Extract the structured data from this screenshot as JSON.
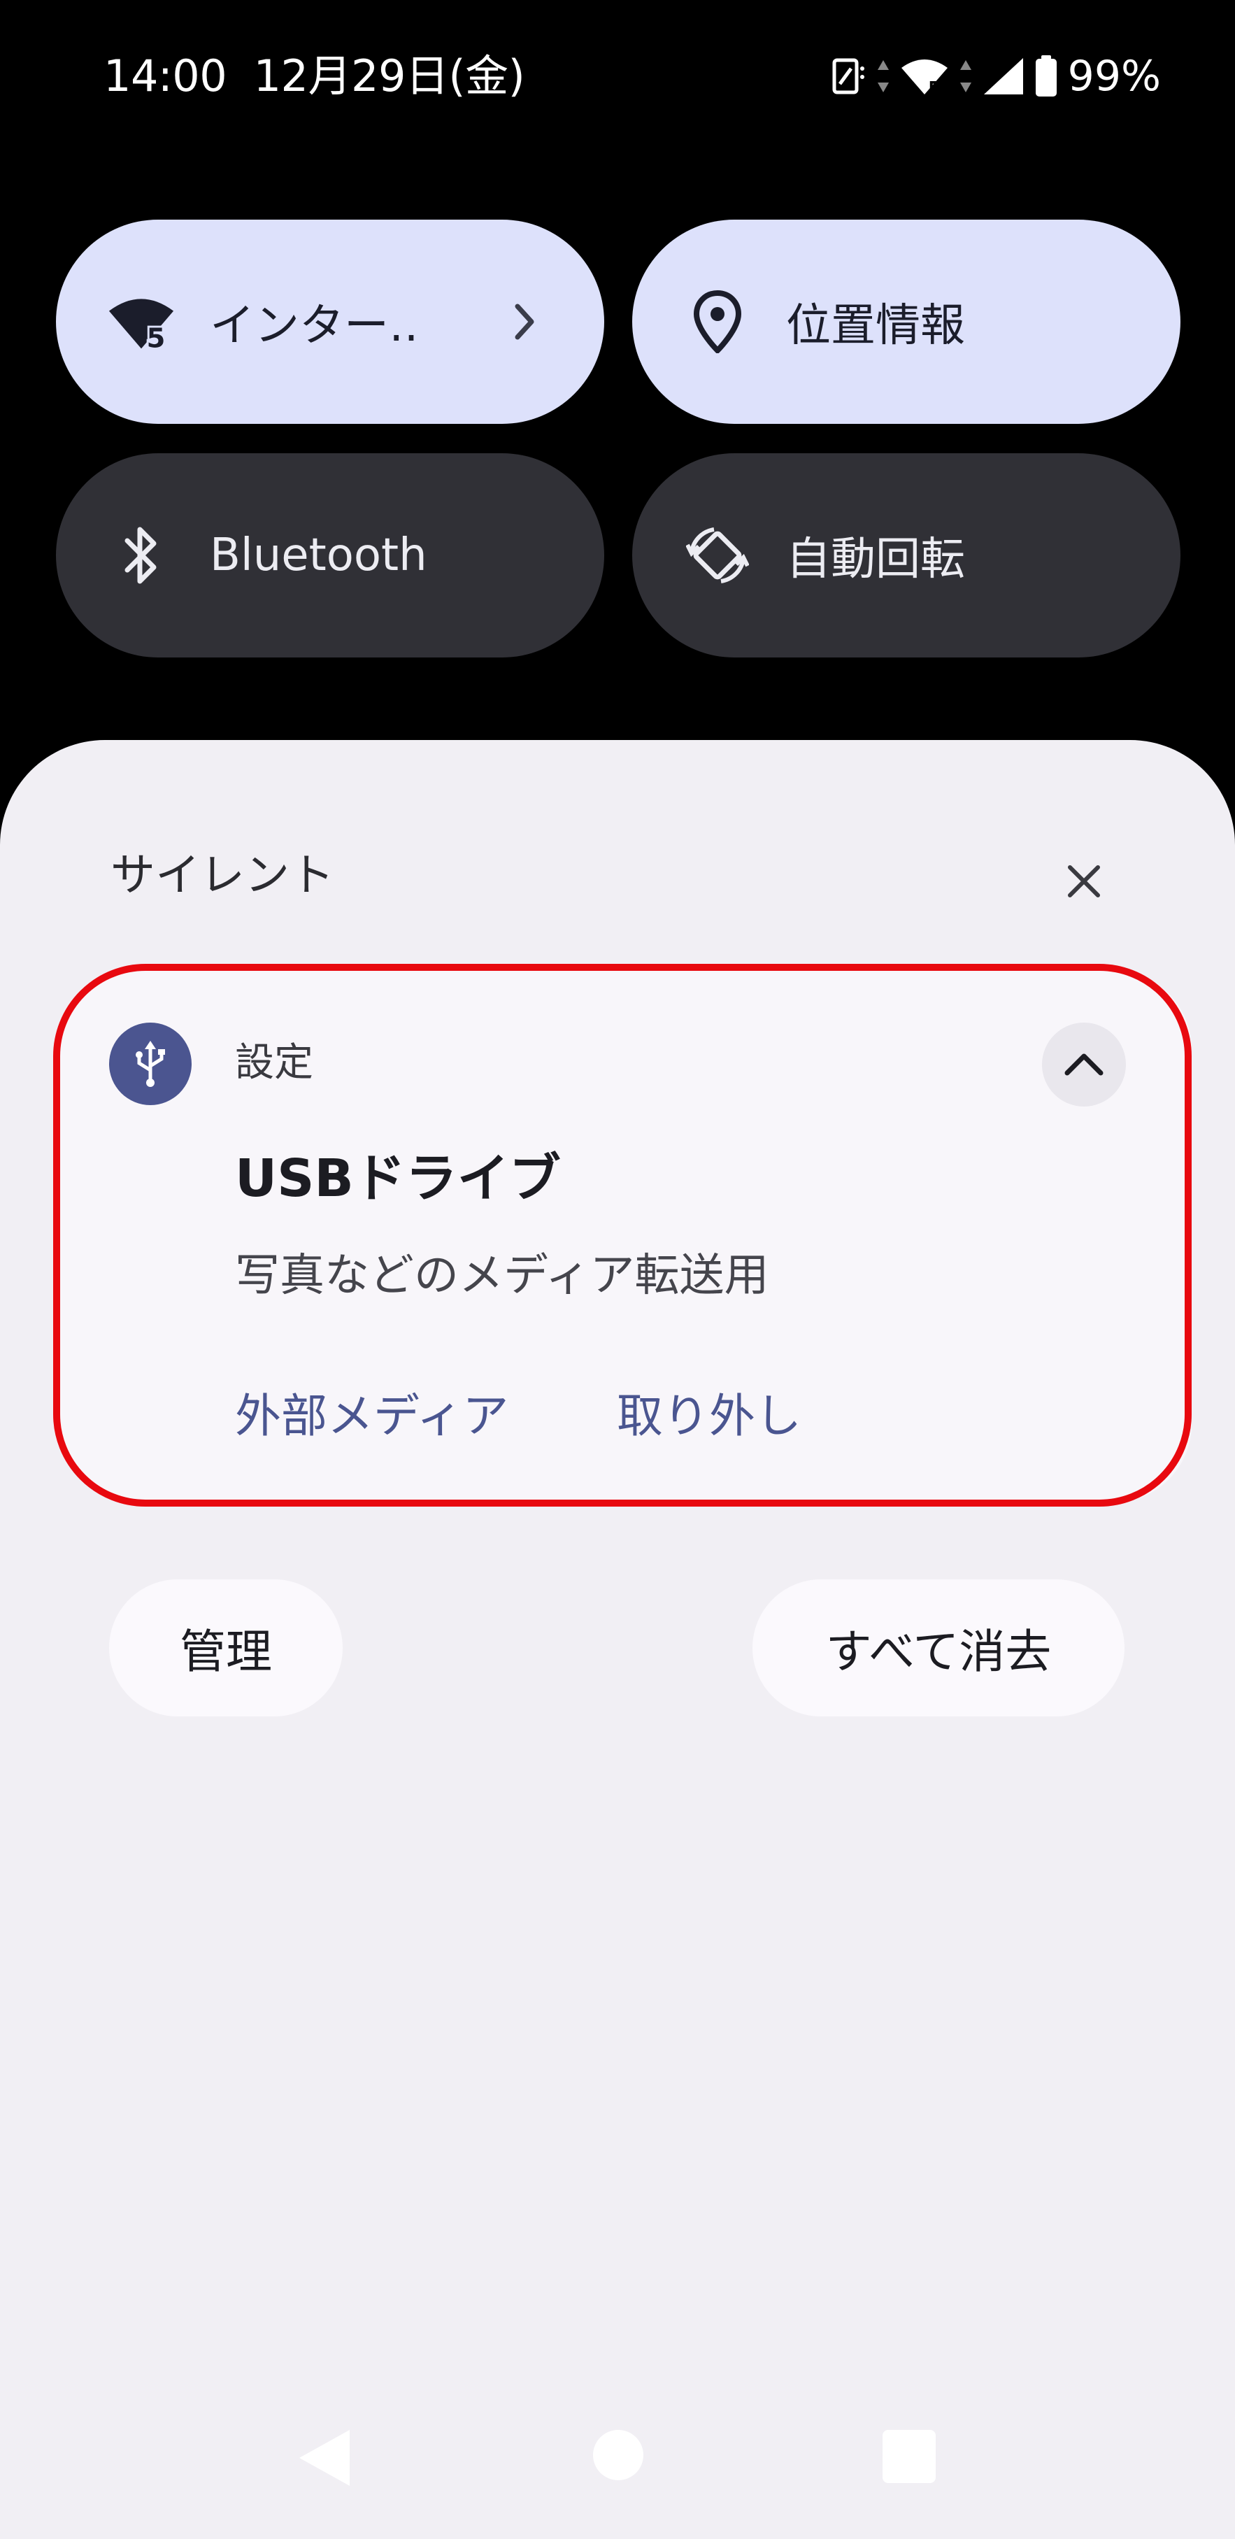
{
  "status_bar": {
    "time": "14:00",
    "date": "12月29日(金)",
    "icons": [
      "nfc-icon",
      "data-arrows-icon",
      "wifi-6-icon",
      "data-arrows-icon",
      "cellular-signal-icon",
      "battery-icon"
    ],
    "battery_percent": "99%"
  },
  "quick_settings": {
    "tiles": [
      {
        "label": "インター‥",
        "icon": "wifi-5-icon",
        "state": "on",
        "has_chevron": true
      },
      {
        "label": "位置情報",
        "icon": "location-pin-icon",
        "state": "on"
      },
      {
        "label": "Bluetooth",
        "icon": "bluetooth-icon",
        "state": "off"
      },
      {
        "label": "自動回転",
        "icon": "auto-rotate-icon",
        "state": "off"
      }
    ]
  },
  "notifications": {
    "section_title": "サイレント",
    "close_icon": "close-icon",
    "card": {
      "app_name": "設定",
      "app_icon": "usb-icon",
      "title": "USBドライブ",
      "text": "写真などのメディア転送用",
      "actions": [
        "外部メディア",
        "取り外し"
      ],
      "highlight_color": "#e8090f"
    },
    "buttons": {
      "manage": "管理",
      "clear_all": "すべて消去"
    }
  },
  "nav_bar": {
    "icons": [
      "back-icon",
      "home-icon",
      "recents-icon"
    ]
  },
  "colors": {
    "tile_active": "#dde1fb",
    "tile_inactive": "#303036",
    "shade_bg": "#f1eff4",
    "accent": "#4a5590"
  }
}
